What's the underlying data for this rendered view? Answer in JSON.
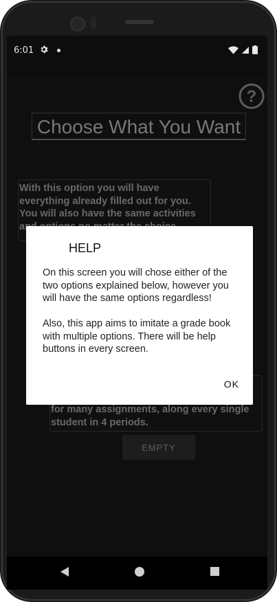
{
  "status": {
    "time": "6:01"
  },
  "app": {
    "title": "Choose What You Want",
    "filled_option_text": "With this option you will have everything already filled out for you. You will also have the same activities and options no matter the choice.",
    "empty_option_text": "for many assignments, along every single student in 4 periods.",
    "empty_button_label": "EMPTY",
    "help_icon": "help-circle-icon"
  },
  "dialog": {
    "title": "HELP",
    "paragraph1": "On this screen you will chose either of the two options explained below, however you will have the same options regardless!",
    "paragraph2": "Also, this app aims to imitate a grade book with multiple options. There will be help buttons in every screen.",
    "ok_label": "OK"
  },
  "nav": {
    "back_icon": "back-triangle-icon",
    "home_icon": "home-circle-icon",
    "recents_icon": "recents-square-icon"
  }
}
